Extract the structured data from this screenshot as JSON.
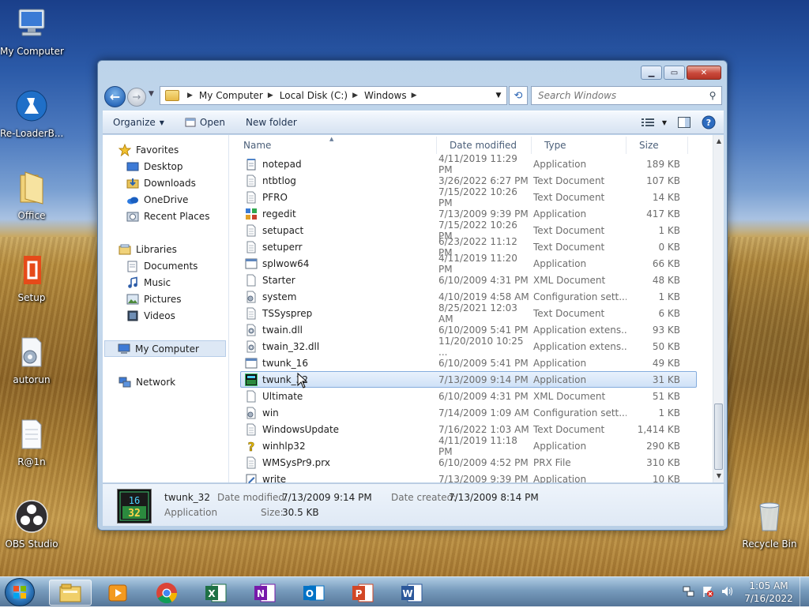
{
  "desktop": {
    "icons": [
      {
        "label": "My Computer"
      },
      {
        "label": "Re-LoaderB..."
      },
      {
        "label": "Office"
      },
      {
        "label": "Setup"
      },
      {
        "label": "autorun"
      },
      {
        "label": "R@1n"
      },
      {
        "label": "OBS Studio"
      },
      {
        "label": "Recycle Bin"
      }
    ]
  },
  "window": {
    "controls": {
      "minimize": "▁",
      "maximize": "▭",
      "close": "✕"
    },
    "address": {
      "crumbs": [
        "My Computer",
        "Local Disk (C:)",
        "Windows"
      ]
    },
    "search": {
      "placeholder": "Search Windows"
    },
    "toolbar": {
      "organize": "Organize",
      "open": "Open",
      "new_folder": "New folder"
    },
    "nav": {
      "favorites": "Favorites",
      "desktop": "Desktop",
      "downloads": "Downloads",
      "onedrive": "OneDrive",
      "recent": "Recent Places",
      "libraries": "Libraries",
      "documents": "Documents",
      "music": "Music",
      "pictures": "Pictures",
      "videos": "Videos",
      "computer": "My Computer",
      "network": "Network"
    },
    "columns": {
      "name": "Name",
      "date": "Date modified",
      "type": "Type",
      "size": "Size"
    },
    "files": [
      {
        "name": "notepad",
        "date": "4/11/2019 11:29 PM",
        "type": "Application",
        "size": "189 KB",
        "icon": "notepad-icon"
      },
      {
        "name": "ntbtlog",
        "date": "3/26/2022 6:27 PM",
        "type": "Text Document",
        "size": "107 KB",
        "icon": "text-file-icon"
      },
      {
        "name": "PFRO",
        "date": "7/15/2022 10:26 PM",
        "type": "Text Document",
        "size": "14 KB",
        "icon": "text-file-icon"
      },
      {
        "name": "regedit",
        "date": "7/13/2009 9:39 PM",
        "type": "Application",
        "size": "417 KB",
        "icon": "regedit-icon"
      },
      {
        "name": "setupact",
        "date": "7/15/2022 10:26 PM",
        "type": "Text Document",
        "size": "1 KB",
        "icon": "text-file-icon"
      },
      {
        "name": "setuperr",
        "date": "6/23/2022 11:12 PM",
        "type": "Text Document",
        "size": "0 KB",
        "icon": "text-file-icon"
      },
      {
        "name": "splwow64",
        "date": "4/11/2019 11:20 PM",
        "type": "Application",
        "size": "66 KB",
        "icon": "application-icon"
      },
      {
        "name": "Starter",
        "date": "6/10/2009 4:31 PM",
        "type": "XML Document",
        "size": "48 KB",
        "icon": "xml-file-icon"
      },
      {
        "name": "system",
        "date": "4/10/2019 4:58 AM",
        "type": "Configuration sett...",
        "size": "1 KB",
        "icon": "config-file-icon"
      },
      {
        "name": "TSSysprep",
        "date": "8/25/2021 12:03 AM",
        "type": "Text Document",
        "size": "6 KB",
        "icon": "text-file-icon"
      },
      {
        "name": "twain.dll",
        "date": "6/10/2009 5:41 PM",
        "type": "Application extens...",
        "size": "93 KB",
        "icon": "dll-file-icon"
      },
      {
        "name": "twain_32.dll",
        "date": "11/20/2010 10:25 ...",
        "type": "Application extens...",
        "size": "50 KB",
        "icon": "dll-file-icon"
      },
      {
        "name": "twunk_16",
        "date": "6/10/2009 5:41 PM",
        "type": "Application",
        "size": "49 KB",
        "icon": "application-icon"
      },
      {
        "name": "twunk_32",
        "date": "7/13/2009 9:14 PM",
        "type": "Application",
        "size": "31 KB",
        "icon": "twunk-icon",
        "selected": true
      },
      {
        "name": "Ultimate",
        "date": "6/10/2009 4:31 PM",
        "type": "XML Document",
        "size": "51 KB",
        "icon": "xml-file-icon"
      },
      {
        "name": "win",
        "date": "7/14/2009 1:09 AM",
        "type": "Configuration sett...",
        "size": "1 KB",
        "icon": "config-file-icon"
      },
      {
        "name": "WindowsUpdate",
        "date": "7/16/2022 1:03 AM",
        "type": "Text Document",
        "size": "1,414 KB",
        "icon": "text-file-icon"
      },
      {
        "name": "winhlp32",
        "date": "4/11/2019 11:18 PM",
        "type": "Application",
        "size": "290 KB",
        "icon": "help-icon"
      },
      {
        "name": "WMSysPr9.prx",
        "date": "6/10/2009 4:52 PM",
        "type": "PRX File",
        "size": "310 KB",
        "icon": "text-file-icon"
      },
      {
        "name": "write",
        "date": "7/13/2009 9:39 PM",
        "type": "Application",
        "size": "10 KB",
        "icon": "write-icon"
      }
    ],
    "details": {
      "name": "twunk_32",
      "type": "Application",
      "thumb_top": "16",
      "thumb_bottom": "32",
      "modified_label": "Date modified:",
      "modified": "7/13/2009 9:14 PM",
      "created_label": "Date created:",
      "created": "7/13/2009 8:14 PM",
      "size_label": "Size:",
      "size": "30.5 KB"
    }
  },
  "taskbar": {
    "time": "1:05 AM",
    "date": "7/16/2022"
  },
  "colors": {
    "selection": "#cfe1f7",
    "accent": "#2e6dbd"
  }
}
